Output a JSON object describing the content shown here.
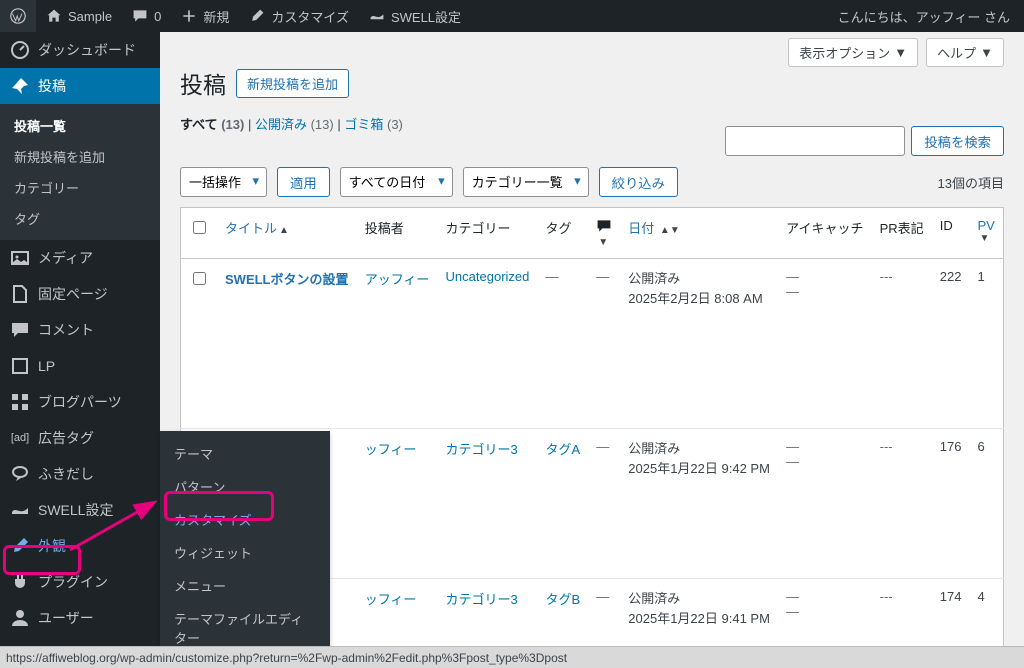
{
  "topbar": {
    "site_name": "Sample",
    "comments": "0",
    "new": "新規",
    "customize": "カスタマイズ",
    "swell": "SWELL設定",
    "greeting": "こんにちは、アッフィー さん"
  },
  "sidebar": {
    "dashboard": "ダッシュボード",
    "posts": "投稿",
    "posts_sub": {
      "list": "投稿一覧",
      "new": "新規投稿を追加",
      "cats": "カテゴリー",
      "tags": "タグ"
    },
    "media": "メディア",
    "pages": "固定ページ",
    "comments": "コメント",
    "lp": "LP",
    "blogparts": "ブログパーツ",
    "adtag_prefix": "[ad]",
    "adtag": "広告タグ",
    "balloon": "ふきだし",
    "swell": "SWELL設定",
    "appearance": "外観",
    "plugins": "プラグイン",
    "users": "ユーザー"
  },
  "flyout": {
    "themes": "テーマ",
    "patterns": "パターン",
    "customize": "カスタマイズ",
    "widgets": "ウィジェット",
    "menus": "メニュー",
    "editor": "テーマファイルエディター"
  },
  "head": {
    "title": "投稿",
    "add_new": "新規投稿を追加",
    "screen_opts": "表示オプション",
    "help": "ヘルプ"
  },
  "subsub": {
    "all": "すべて",
    "all_cnt": "(13)",
    "published": "公開済み",
    "published_cnt": "(13)",
    "trash": "ゴミ箱",
    "trash_cnt": "(3)"
  },
  "search": {
    "button": "投稿を検索",
    "placeholder": ""
  },
  "tablenav": {
    "bulk": "一括操作",
    "apply": "適用",
    "alldates": "すべての日付",
    "catlist": "カテゴリー一覧",
    "filter": "絞り込み",
    "count": "13個の項目"
  },
  "columns": {
    "title": "タイトル",
    "author": "投稿者",
    "cats": "カテゴリー",
    "tags": "タグ",
    "date": "日付",
    "eyecatch": "アイキャッチ",
    "pr": "PR表記",
    "id": "ID",
    "pv": "PV"
  },
  "rows": [
    {
      "title": "SWELLボタンの設置",
      "author": "アッフィー",
      "cats": "Uncategorized",
      "tags": "—",
      "comments": "—",
      "date_status": "公開済み",
      "date_line": "2025年2月2日 8:08 AM",
      "eyecatch": "—\n—",
      "pr": "---",
      "id": "222",
      "pv": "1"
    },
    {
      "title": "",
      "author": "ッフィー",
      "cats": "カテゴリー3",
      "tags": "タグA",
      "comments": "—",
      "date_status": "公開済み",
      "date_line": "2025年1月22日 9:42 PM",
      "eyecatch": "—\n—",
      "pr": "---",
      "id": "176",
      "pv": "6"
    },
    {
      "title": "",
      "author": "ッフィー",
      "cats": "カテゴリー3",
      "tags": "タグB",
      "comments": "—",
      "date_status": "公開済み",
      "date_line": "2025年1月22日 9:41 PM",
      "eyecatch": "—\n—",
      "pr": "---",
      "id": "174",
      "pv": "4"
    }
  ],
  "statusbar": "https://affiweblog.org/wp-admin/customize.php?return=%2Fwp-admin%2Fedit.php%3Fpost_type%3Dpost"
}
